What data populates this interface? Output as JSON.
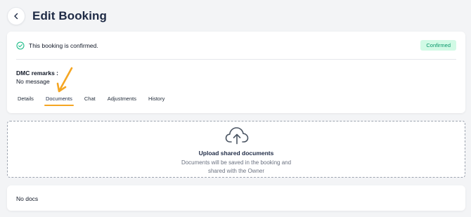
{
  "header": {
    "title": "Edit Booking",
    "back_icon": "chevron-left-icon"
  },
  "booking_status": {
    "message": "This booking is confirmed.",
    "badge": "Confirmed",
    "icon": "check-circle-icon",
    "badge_colors": {
      "background": "#d1fae5",
      "text": "#059669"
    }
  },
  "remarks": {
    "label": "DMC remarks :",
    "value": "No message"
  },
  "tabs": [
    {
      "label": "Details",
      "active": false
    },
    {
      "label": "Documents",
      "active": true
    },
    {
      "label": "Chat",
      "active": false
    },
    {
      "label": "Adjustments",
      "active": false
    },
    {
      "label": "History",
      "active": false
    }
  ],
  "annotation": {
    "icon": "arrow-annotation-icon",
    "color": "#f5a623"
  },
  "upload": {
    "icon": "cloud-upload-icon",
    "title": "Upload shared documents",
    "subtitle_line1": "Documents will be saved in the booking and",
    "subtitle_line2": "shared with the Owner"
  },
  "documents": {
    "empty_text": "No docs"
  },
  "colors": {
    "accent": "#f5a623",
    "title": "#1e2a45",
    "background": "#f3f4f6"
  }
}
